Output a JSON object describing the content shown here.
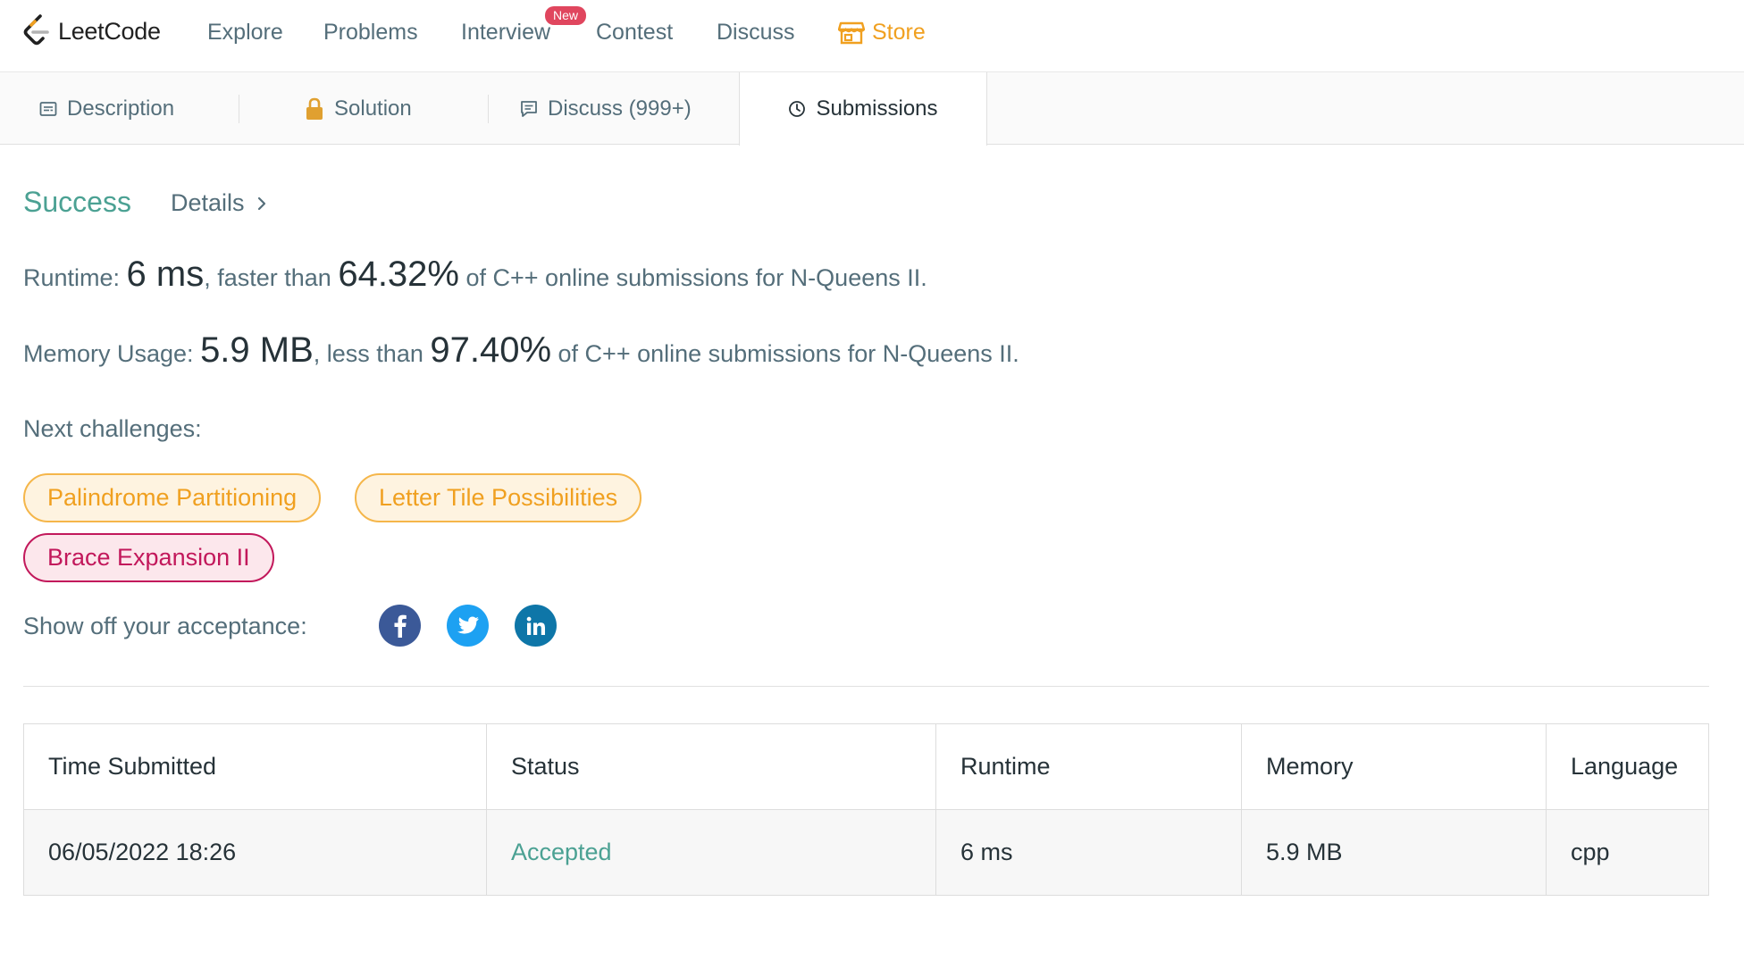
{
  "navbar": {
    "logo_text": "LeetCode",
    "items": {
      "explore": "Explore",
      "problems": "Problems",
      "interview": "Interview",
      "contest": "Contest",
      "discuss": "Discuss",
      "store": "Store"
    },
    "new_badge": "New",
    "icons": {
      "logo": "leetcode-logo",
      "store": "store-icon"
    },
    "colors": {
      "store": "#f0a020",
      "new_badge": "#e0465e"
    }
  },
  "tabs": {
    "description": "Description",
    "solution": "Solution",
    "discuss": "Discuss (999+)",
    "submissions": "Submissions",
    "active": "submissions"
  },
  "result": {
    "status": "Success",
    "details": "Details",
    "runtime": {
      "label": "Runtime: ",
      "value": "6 ms",
      "middle": ", faster than ",
      "percent": "64.32%",
      "suffix": " of C++ online submissions for N-Queens II."
    },
    "memory": {
      "label": "Memory Usage: ",
      "value": "5.9 MB",
      "middle": ", less than ",
      "percent": "97.40%",
      "suffix": " of C++ online submissions for N-Queens II."
    },
    "colors": {
      "success": "#4ba193"
    }
  },
  "next_challenges": {
    "label": "Next challenges:",
    "items": [
      {
        "title": "Palindrome Partitioning",
        "difficulty": "medium"
      },
      {
        "title": "Letter Tile Possibilities",
        "difficulty": "medium"
      },
      {
        "title": "Brace Expansion II",
        "difficulty": "hard"
      }
    ],
    "colors": {
      "medium": "#f0a020",
      "hard": "#c2185b"
    }
  },
  "share": {
    "label": "Show off your acceptance:",
    "icons": [
      "facebook-icon",
      "twitter-icon",
      "linkedin-icon"
    ]
  },
  "submissions_table": {
    "headers": [
      "Time Submitted",
      "Status",
      "Runtime",
      "Memory",
      "Language"
    ],
    "rows": [
      [
        "06/05/2022 18:26",
        "Accepted",
        "6 ms",
        "5.9 MB",
        "cpp"
      ]
    ]
  }
}
